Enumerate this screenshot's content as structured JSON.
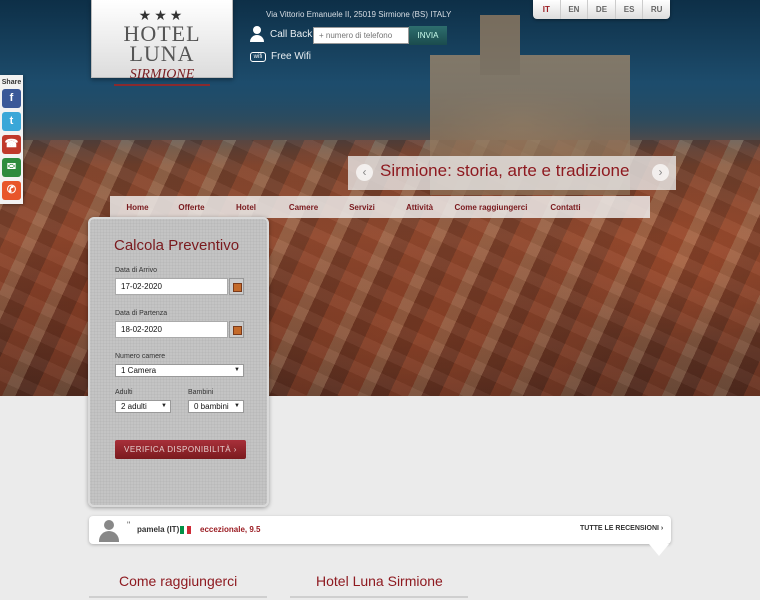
{
  "brand": {
    "stars": "★★★",
    "name": "HOTEL LUNA",
    "location": "SIRMIONE"
  },
  "topbar": {
    "address": "Via Vittorio Emanuele II, 25019 Sirmione (BS) ITALY",
    "callback_label": "Call Back",
    "phone_placeholder": "+ numero di telefono",
    "send_label": "INVIA",
    "wifi_label": "Free Wifi"
  },
  "languages": [
    {
      "code": "IT",
      "active": true
    },
    {
      "code": "EN",
      "active": false
    },
    {
      "code": "DE",
      "active": false
    },
    {
      "code": "ES",
      "active": false
    },
    {
      "code": "RU",
      "active": false
    }
  ],
  "share": {
    "label": "Share",
    "icons": [
      "facebook-icon",
      "twitter-icon",
      "tumblr-icon",
      "mail-icon",
      "phone-icon"
    ]
  },
  "banner": {
    "title": "Sirmione: storia, arte e tradizione"
  },
  "nav": [
    "Home",
    "Offerte",
    "Hotel",
    "Camere",
    "Servizi",
    "Attività",
    "Come raggiungerci",
    "Contatti"
  ],
  "booking": {
    "title": "Calcola Preventivo",
    "arrival_label": "Data di Arrivo",
    "arrival_value": "17-02-2020",
    "departure_label": "Data di Partenza",
    "departure_value": "18-02-2020",
    "rooms_label": "Numero camere",
    "rooms_value": "1 Camera",
    "adults_label": "Adulti",
    "adults_value": "2 adulti",
    "children_label": "Bambini",
    "children_value": "0 bambini",
    "submit_label": "VERIFICA DISPONIBILITÀ ›"
  },
  "review": {
    "quote_mark": "\"",
    "reviewer": "pamela (IT)",
    "score_text": "eccezionale, 9.5",
    "all_reviews_label": "TUTTE LE RECENSIONI ›"
  },
  "footer_headings": [
    "Come raggiungerci",
    "Hotel Luna Sirmione"
  ],
  "colors": {
    "accent": "#8e1a20",
    "lake": "#1d4c6c"
  }
}
